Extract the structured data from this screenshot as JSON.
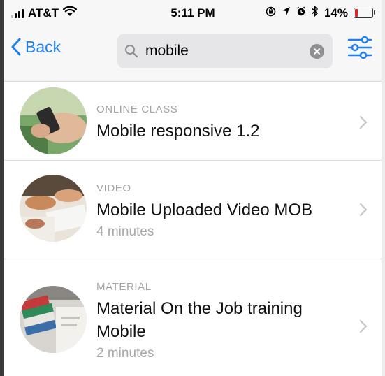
{
  "status_bar": {
    "carrier": "AT&T",
    "time": "5:11 PM",
    "battery_percent": "14%",
    "battery_level": 0.14,
    "icons": [
      "signal-icon",
      "wifi-icon",
      "lock-rotation-icon",
      "location-icon",
      "alarm-icon",
      "bluetooth-icon",
      "battery-icon"
    ]
  },
  "nav": {
    "back_label": "Back",
    "search_value": "mobile",
    "icons": [
      "back-chevron-icon",
      "search-icon",
      "clear-icon",
      "filter-sliders-icon"
    ]
  },
  "results": [
    {
      "type": "ONLINE CLASS",
      "title": "Mobile responsive 1.2",
      "meta": ""
    },
    {
      "type": "VIDEO",
      "title": "Mobile Uploaded Video MOB",
      "meta": "4 minutes"
    },
    {
      "type": "MATERIAL",
      "title": "Material On the Job training Mobile",
      "meta": "2 minutes"
    }
  ],
  "colors": {
    "accent": "#1e7ff0",
    "battery_low": "#e0262b",
    "secondary_text": "#a3a3a3"
  }
}
